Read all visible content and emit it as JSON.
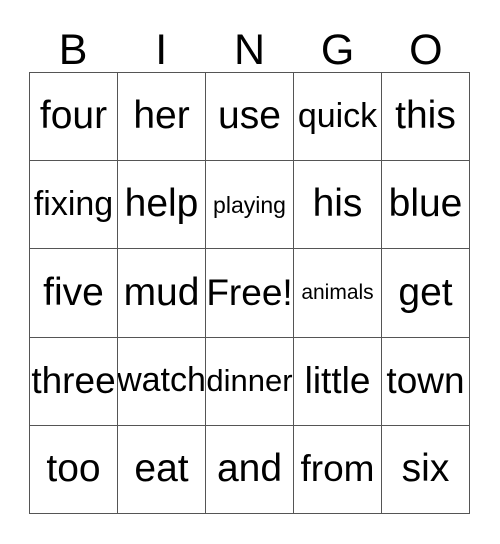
{
  "card": {
    "type": "bingo-card",
    "header": {
      "letters": [
        "B",
        "I",
        "N",
        "G",
        "O"
      ]
    },
    "grid": {
      "columns": 5,
      "rows": 5,
      "border_color": "#555555",
      "background_color": "#ffffff",
      "text_color": "#000000",
      "free_space": {
        "row": 3,
        "column": 3,
        "label": "Free!"
      },
      "cells": [
        [
          {
            "text": "four",
            "size": "fs-xl"
          },
          {
            "text": "her",
            "size": "fs-xl"
          },
          {
            "text": "use",
            "size": "fs-xl"
          },
          {
            "text": "quick",
            "size": "fs-md"
          },
          {
            "text": "this",
            "size": "fs-xl"
          }
        ],
        [
          {
            "text": "fixing",
            "size": "fs-md"
          },
          {
            "text": "help",
            "size": "fs-xl"
          },
          {
            "text": "playing",
            "size": "fs-xs"
          },
          {
            "text": "his",
            "size": "fs-xl"
          },
          {
            "text": "blue",
            "size": "fs-xl"
          }
        ],
        [
          {
            "text": "five",
            "size": "fs-xl"
          },
          {
            "text": "mud",
            "size": "fs-xl"
          },
          {
            "text": "Free!",
            "size": "fs-lg"
          },
          {
            "text": "animals",
            "size": "fs-xxs"
          },
          {
            "text": "get",
            "size": "fs-xl"
          }
        ],
        [
          {
            "text": "three",
            "size": "fs-lg"
          },
          {
            "text": "watch",
            "size": "fs-md"
          },
          {
            "text": "dinner",
            "size": "fs-sm"
          },
          {
            "text": "little",
            "size": "fs-lg"
          },
          {
            "text": "town",
            "size": "fs-lg"
          }
        ],
        [
          {
            "text": "too",
            "size": "fs-xl"
          },
          {
            "text": "eat",
            "size": "fs-xl"
          },
          {
            "text": "and",
            "size": "fs-xl"
          },
          {
            "text": "from",
            "size": "fs-lg"
          },
          {
            "text": "six",
            "size": "fs-xl"
          }
        ]
      ]
    }
  }
}
